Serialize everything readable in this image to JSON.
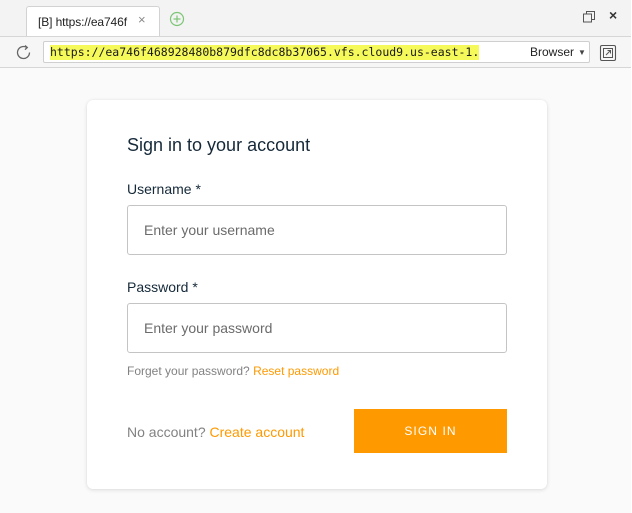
{
  "browser": {
    "tab_title": "[B] https://ea746f",
    "tab_close": "×",
    "window_close": "×",
    "url": "https://ea746f468928480b879dfc8dc8b37065.vfs.cloud9.us-east-1.",
    "browser_menu_label": "Browser",
    "caret": "▼"
  },
  "form": {
    "title": "Sign in to your account",
    "username_label": "Username *",
    "username_placeholder": "Enter your username",
    "password_label": "Password *",
    "password_placeholder": "Enter your password",
    "forgot_text": "Forget your password?",
    "reset_link": "Reset password",
    "no_account_text": "No account?",
    "create_account_link": "Create account",
    "sign_in_label": "SIGN IN"
  },
  "colors": {
    "accent": "#ff9900",
    "heading": "#152939",
    "muted": "#828282",
    "url_highlight": "#f6f95a"
  }
}
